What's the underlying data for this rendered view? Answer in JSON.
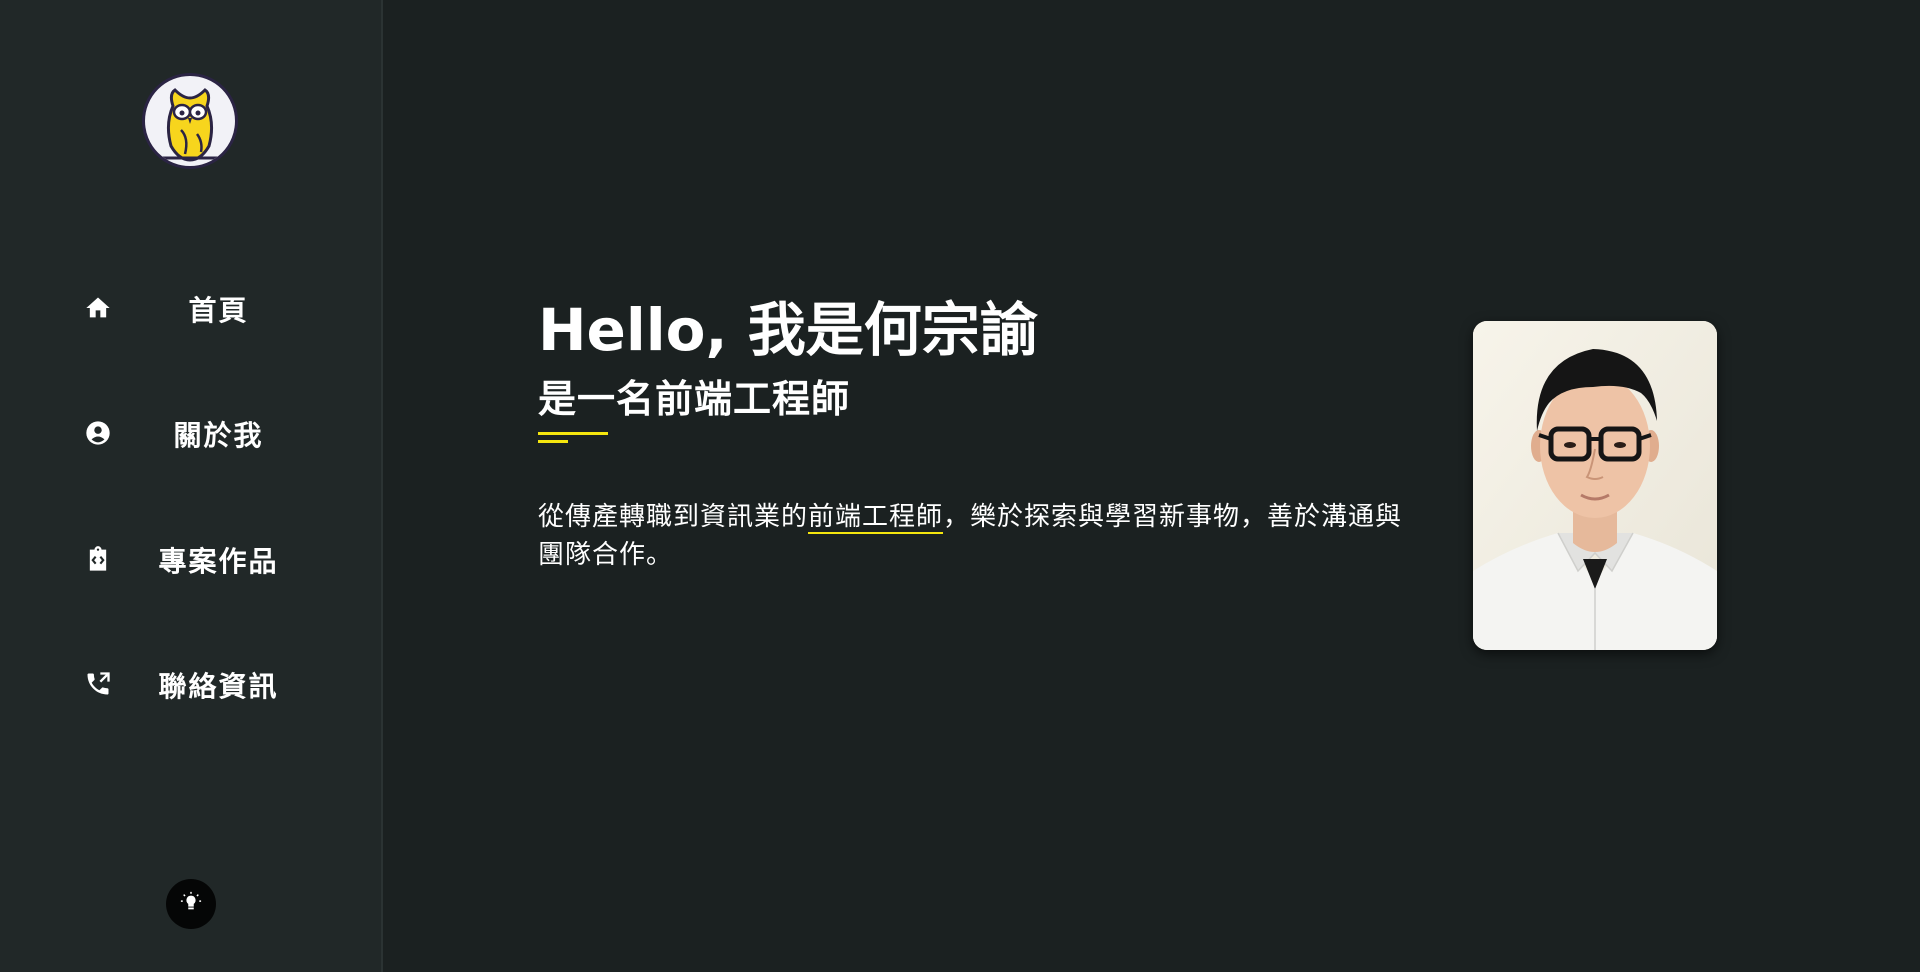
{
  "sidebar": {
    "logo_name": "owl-logo",
    "items": [
      {
        "label": "首頁",
        "icon": "home-icon"
      },
      {
        "label": "關於我",
        "icon": "account-circle-icon"
      },
      {
        "label": "專案作品",
        "icon": "code-clipboard-icon"
      },
      {
        "label": "聯絡資訊",
        "icon": "phone-icon"
      }
    ],
    "theme_toggle_icon": "lightbulb-icon"
  },
  "hero": {
    "title": "Hello, 我是何宗諭",
    "subtitle": "是一名前端工程師",
    "desc_part1": "從傳產轉職到資訊業的",
    "desc_highlight": "前端工程師",
    "desc_part2": "，樂於探索與學習新事物，善於溝通與團隊合作。"
  },
  "colors": {
    "background": "#1b2121",
    "sidebar": "#212828",
    "accent": "#f5e60e",
    "text": "#ffffff"
  }
}
